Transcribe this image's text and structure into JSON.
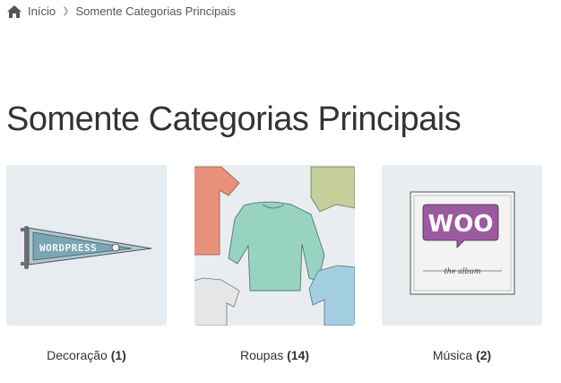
{
  "breadcrumb": {
    "home_label": "Início",
    "current": "Somente Categorias Principais"
  },
  "page_title": "Somente Categorias Principais",
  "categories": [
    {
      "name": "Decoração",
      "count": "(1)",
      "image": "wordpress-pennant"
    },
    {
      "name": "Roupas",
      "count": "(14)",
      "image": "clothing"
    },
    {
      "name": "Música",
      "count": "(2)",
      "image": "woo-album"
    }
  ],
  "images": {
    "pennant_text": "WORDPRESS",
    "album_logo": "WOO",
    "album_subtitle": "the album"
  },
  "colors": {
    "thumb_bg": "#e7ecf0",
    "title": "#333333",
    "text": "#43454b"
  }
}
